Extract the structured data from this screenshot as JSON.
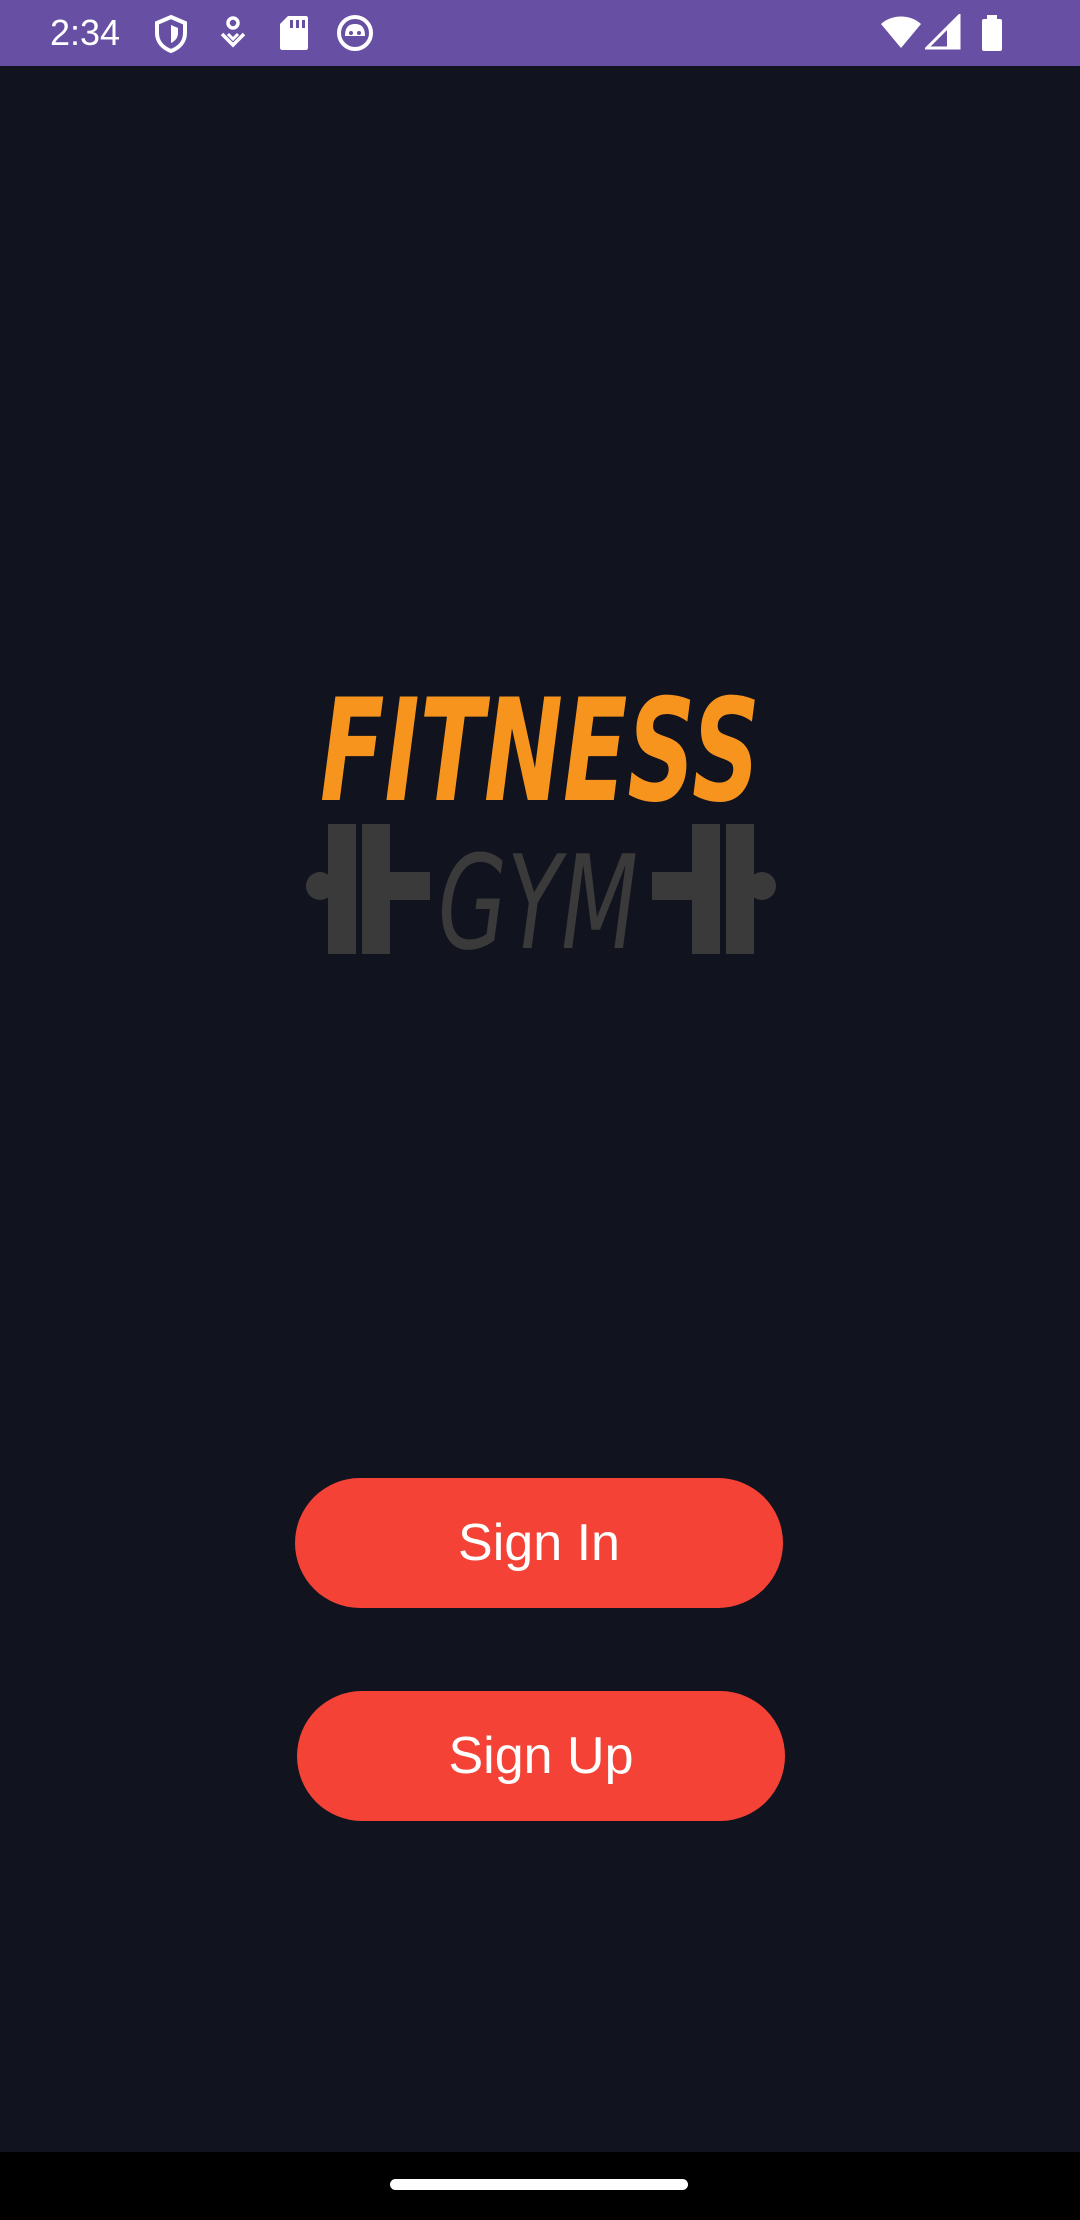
{
  "status_bar": {
    "time": "2:34",
    "icons": [
      "shield-icon",
      "location-pin-icon",
      "sd-card-icon",
      "cat-face-icon",
      "wifi-icon",
      "signal-icon",
      "battery-icon"
    ]
  },
  "logo": {
    "line1": "FITNESS",
    "line2": "GYM"
  },
  "buttons": {
    "sign_in": "Sign In",
    "sign_up": "Sign Up"
  },
  "colors": {
    "status_bar": "#6750a4",
    "background": "#11131f",
    "button": "#f44336",
    "logo_orange": "#f7941d",
    "logo_gray": "#3a3a3a"
  }
}
